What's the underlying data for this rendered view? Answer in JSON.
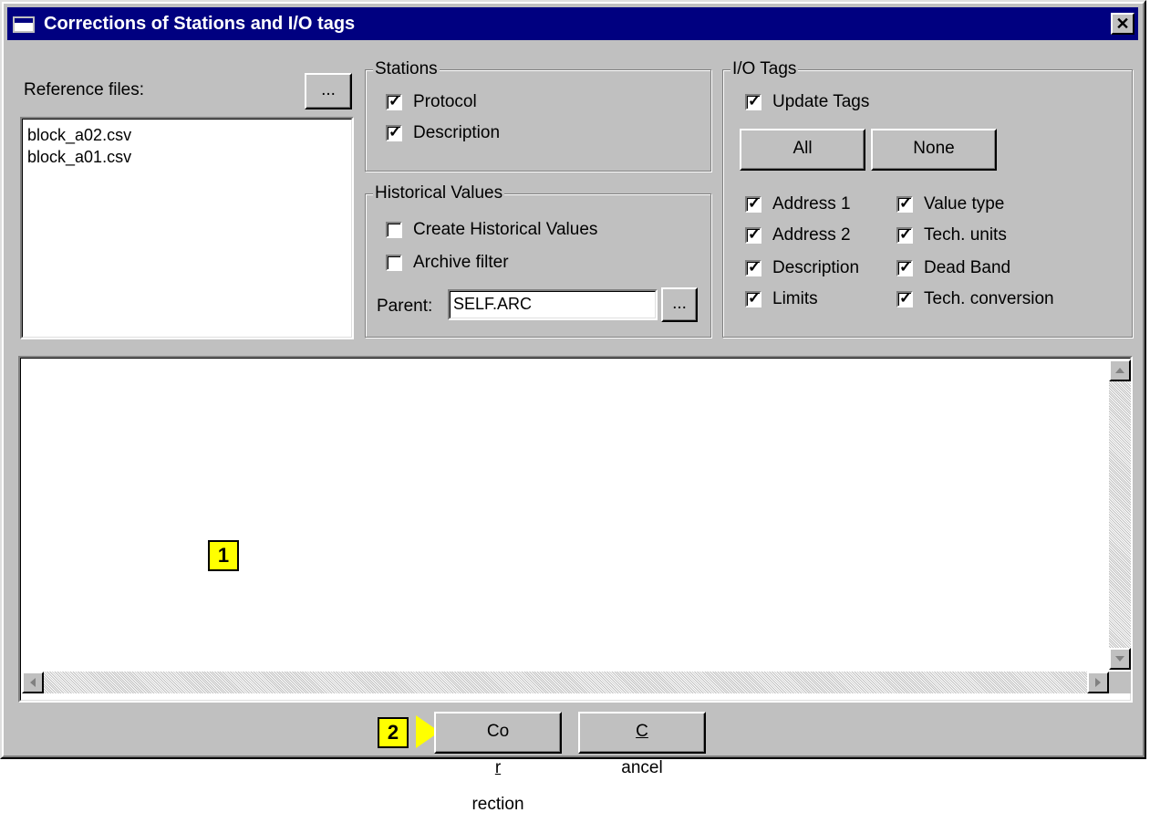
{
  "window": {
    "title": "Corrections of Stations and I/O tags",
    "close_glyph": "✕"
  },
  "reference": {
    "label": "Reference files:",
    "browse_label": "...",
    "files": [
      "block_a02.csv",
      "block_a01.csv"
    ]
  },
  "stations": {
    "title": "Stations",
    "protocol": {
      "label": "Protocol",
      "checked": true
    },
    "description": {
      "label": "Description",
      "checked": true
    }
  },
  "historical": {
    "title": "Historical Values",
    "create": {
      "label": "Create Historical Values",
      "checked": false
    },
    "archive": {
      "label": "Archive filter",
      "checked": false
    },
    "parent_label": "Parent:",
    "parent_value": "SELF.ARC",
    "browse_label": "..."
  },
  "io_tags": {
    "title": "I/O Tags",
    "update": {
      "label": "Update Tags",
      "checked": true
    },
    "all_label": "All",
    "none_label": "None",
    "left_items": [
      "Address 1",
      "Address 2",
      "Description",
      "Limits"
    ],
    "right_items": [
      "Value type",
      "Tech. units",
      "Dead Band",
      "Tech. conversion"
    ]
  },
  "annotations": {
    "badge1": "1",
    "badge2": "2"
  },
  "buttons": {
    "correction_pre": "Co",
    "correction_u": "r",
    "correction_post": "rection",
    "cancel_u": "C",
    "cancel_post": "ancel"
  },
  "colors": {
    "titlebar": "#000080",
    "face": "#c0c0c0",
    "badge": "#ffff00"
  }
}
